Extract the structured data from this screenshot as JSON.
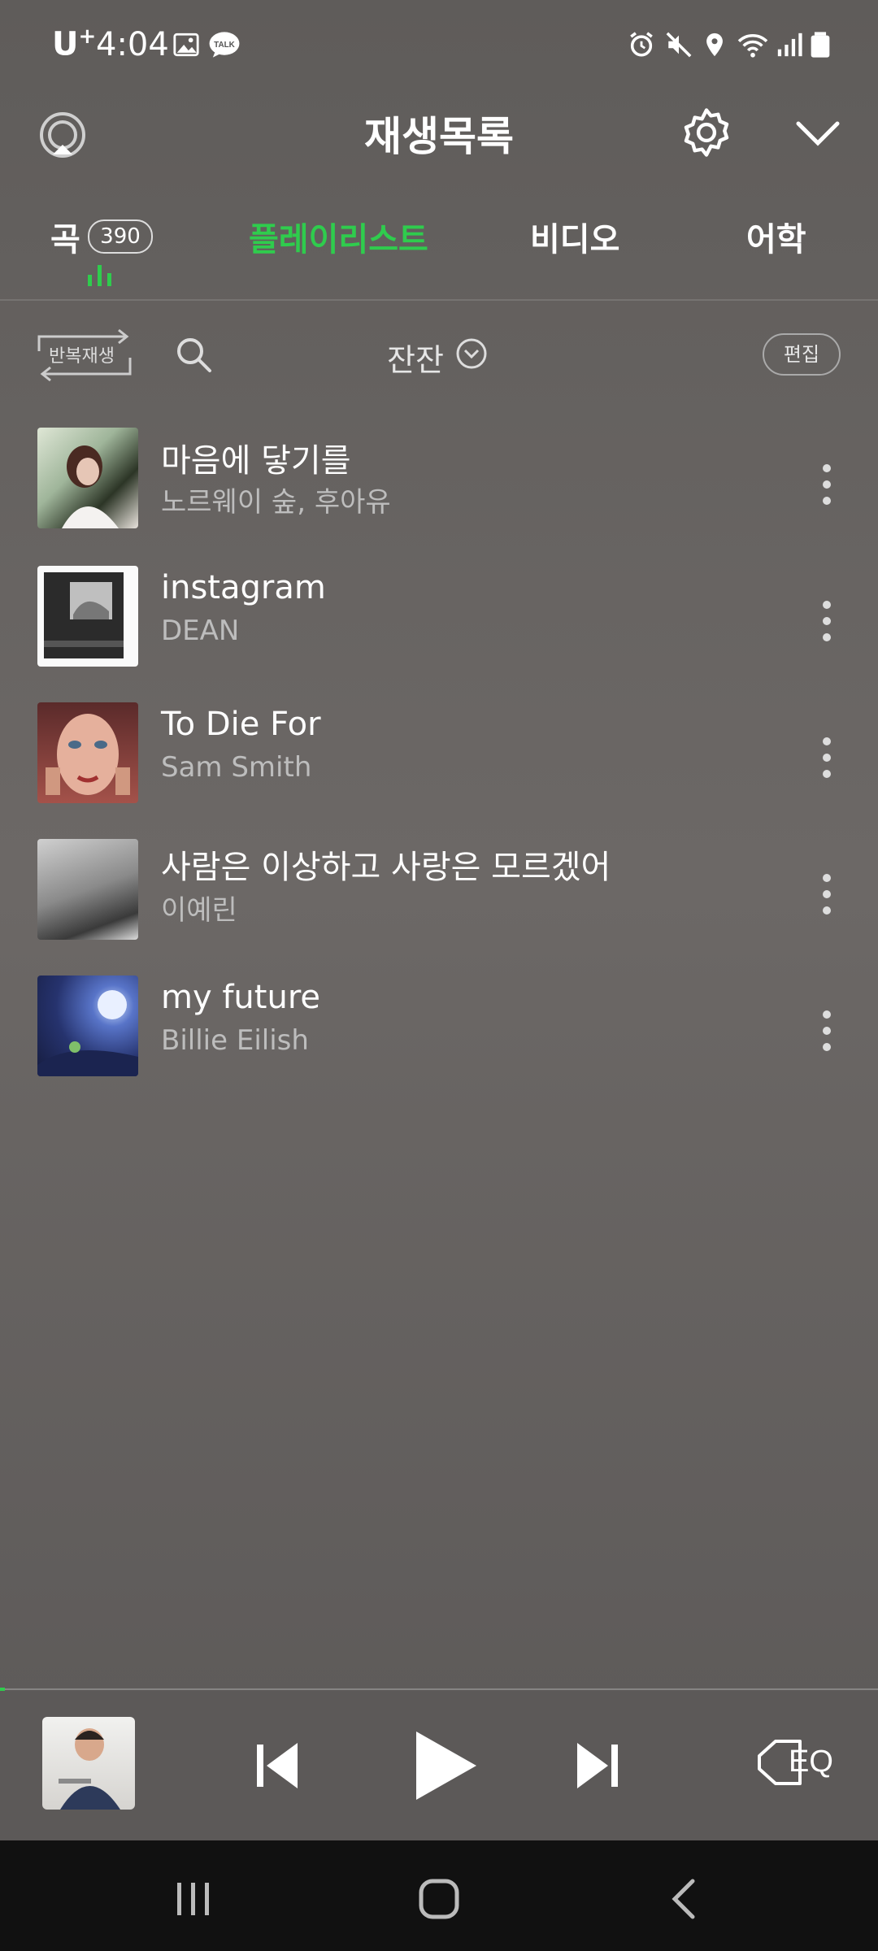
{
  "status_bar": {
    "carrier": "U",
    "carrier_sup": "+",
    "time": "4:04"
  },
  "header": {
    "title": "재생목록"
  },
  "tabs": [
    {
      "label": "곡",
      "badge": "390",
      "active": false
    },
    {
      "label": "플레이리스트",
      "active": true
    },
    {
      "label": "비디오",
      "active": false
    },
    {
      "label": "어학",
      "active": false
    }
  ],
  "toolbar": {
    "repeat_label": "반복재생",
    "playlist_name": "잔잔",
    "edit_label": "편집"
  },
  "tracks": [
    {
      "title": "마음에 닿기를",
      "artist": "노르웨이 숲, 후아유"
    },
    {
      "title": "instagram",
      "artist": "DEAN"
    },
    {
      "title": "To Die For",
      "artist": "Sam Smith"
    },
    {
      "title": "사람은 이상하고 사랑은 모르겠어",
      "artist": "이예린"
    },
    {
      "title": "my future",
      "artist": "Billie Eilish"
    }
  ],
  "player": {
    "eq_label": "EQ",
    "progress": 0.005
  },
  "colors": {
    "accent": "#2fcc4d",
    "nav_bg": "#111111"
  }
}
